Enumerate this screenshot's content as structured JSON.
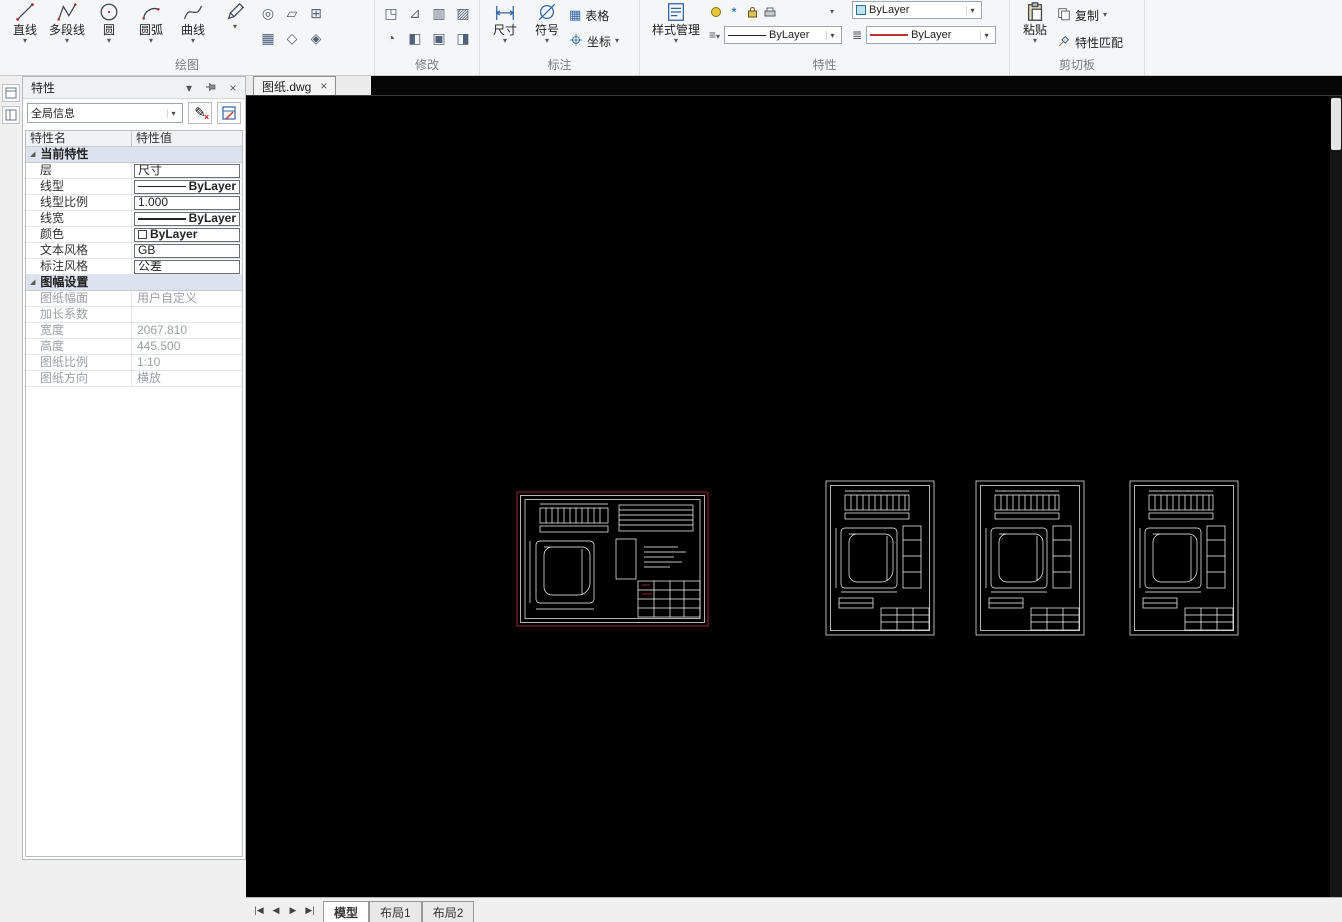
{
  "colors": {
    "canvas_background": "#000000",
    "selection_outline": "#d23b3b",
    "drawing_lines": "#ffffff",
    "lineweight_sample_red": "#c23030"
  },
  "icons": {
    "caret": "▾",
    "close": "×",
    "expand": "◢",
    "menu": "≡",
    "lines": "≣",
    "nav_first": "|◀",
    "nav_prev": "◀",
    "nav_next": "▶",
    "nav_last": "▶|",
    "pencil": "✎"
  },
  "ribbon": {
    "draw": {
      "label": "绘图",
      "tools": [
        {
          "label": "直线"
        },
        {
          "label": "多段线"
        },
        {
          "label": "圆"
        },
        {
          "label": "圆弧"
        },
        {
          "label": "曲线"
        }
      ]
    },
    "modify": {
      "label": "修改"
    },
    "annotate": {
      "label": "标注",
      "dimension": "尺寸",
      "symbol": "符号",
      "table": "表格",
      "coordinate": "坐标"
    },
    "properties": {
      "label": "特性",
      "style_manager": "样式管理",
      "layer_color_value": "ByLayer",
      "linetype_value": "ByLayer",
      "lineweight_value": "ByLayer"
    },
    "clipboard": {
      "label": "剪切板",
      "paste": "粘贴",
      "copy": "复制",
      "match_properties": "特性匹配"
    }
  },
  "palette": {
    "title": "特性",
    "scope_combo_value": "全局信息",
    "columns": {
      "name": "特性名",
      "value": "特性值"
    },
    "groups": [
      {
        "header": "当前特性",
        "rows": [
          {
            "name": "层",
            "value": "尺寸",
            "type": "field"
          },
          {
            "name": "线型",
            "value": "ByLayer",
            "type": "linetype"
          },
          {
            "name": "线型比例",
            "value": "1.000",
            "type": "field"
          },
          {
            "name": "线宽",
            "value": "ByLayer",
            "type": "lineweight"
          },
          {
            "name": "颜色",
            "value": "ByLayer",
            "type": "color"
          },
          {
            "name": "文本风格",
            "value": "GB",
            "type": "field"
          },
          {
            "name": "标注风格",
            "value": "公差",
            "type": "field"
          }
        ]
      },
      {
        "header": "图幅设置",
        "rows": [
          {
            "name": "图纸幅面",
            "value": "用户自定义",
            "type": "muted"
          },
          {
            "name": "加长系数",
            "value": "",
            "type": "muted"
          },
          {
            "name": "宽度",
            "value": "2067.810",
            "type": "muted"
          },
          {
            "name": "高度",
            "value": "445.500",
            "type": "muted"
          },
          {
            "name": "图纸比例",
            "value": "1:10",
            "type": "muted"
          },
          {
            "name": "图纸方向",
            "value": "横放",
            "type": "muted"
          }
        ]
      }
    ]
  },
  "document": {
    "tab": "图纸.dwg"
  },
  "canvas": {
    "drawings": [
      {
        "id": "drawing-1",
        "selected": true
      },
      {
        "id": "drawing-2",
        "selected": false
      },
      {
        "id": "drawing-3",
        "selected": false
      },
      {
        "id": "drawing-4",
        "selected": false
      }
    ]
  },
  "statusbar": {
    "tabs": [
      {
        "label": "模型",
        "active": true
      },
      {
        "label": "布局1",
        "active": false
      },
      {
        "label": "布局2",
        "active": false
      }
    ]
  }
}
